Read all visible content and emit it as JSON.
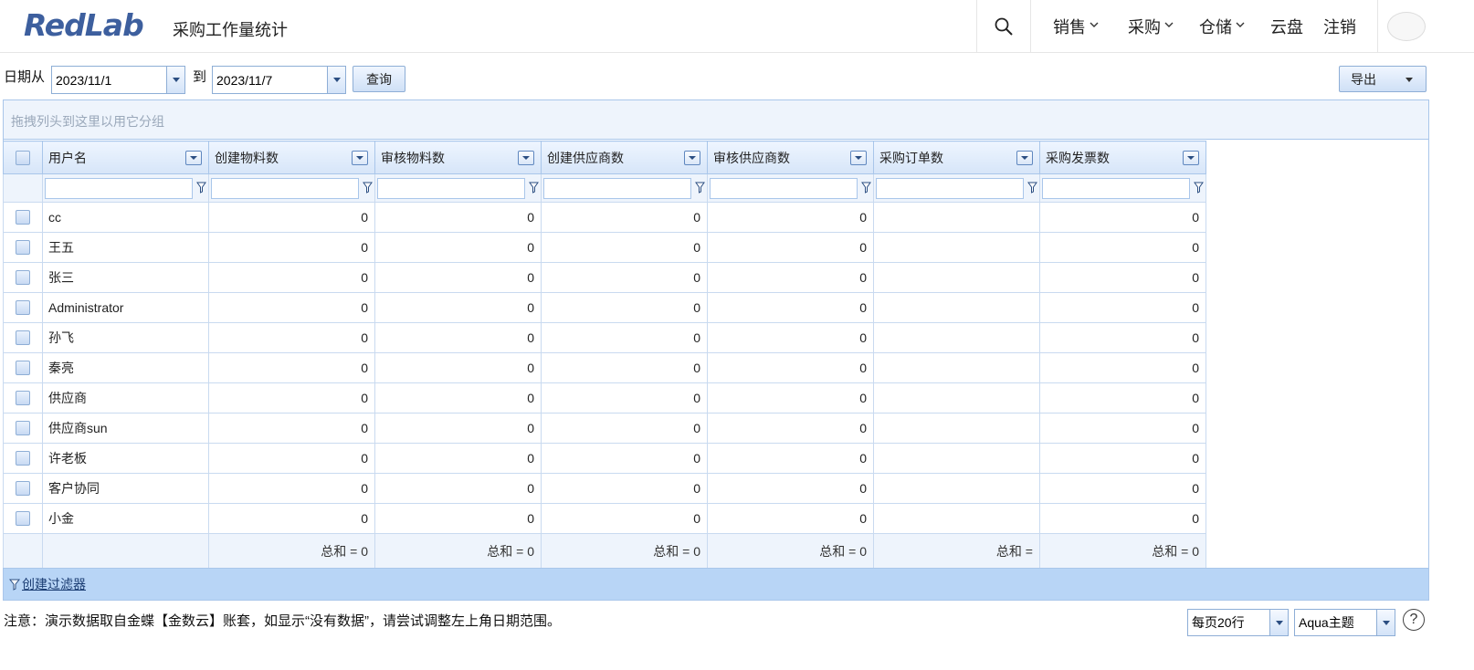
{
  "app": {
    "logo": "RedLab",
    "page_title": "采购工作量统计"
  },
  "nav": [
    {
      "label": "销售",
      "has_menu": true
    },
    {
      "label": "采购",
      "has_menu": true
    },
    {
      "label": "仓储",
      "has_menu": true
    },
    {
      "label": "云盘",
      "has_menu": false
    },
    {
      "label": "注销",
      "has_menu": false
    }
  ],
  "toolbar": {
    "date_from_label": "日期从",
    "date_from": "2023/11/1",
    "to_label": "到",
    "date_to": "2023/11/7",
    "query_label": "查询",
    "export_label": "导出"
  },
  "grid": {
    "group_hint": "拖拽列头到这里以用它分组",
    "columns": [
      "用户名",
      "创建物料数",
      "审核物料数",
      "创建供应商数",
      "审核供应商数",
      "采购订单数",
      "采购发票数"
    ],
    "rows": [
      {
        "name": "cc",
        "values": [
          "0",
          "0",
          "0",
          "0",
          "",
          "0"
        ]
      },
      {
        "name": "王五",
        "values": [
          "0",
          "0",
          "0",
          "0",
          "",
          "0"
        ]
      },
      {
        "name": "张三",
        "values": [
          "0",
          "0",
          "0",
          "0",
          "",
          "0"
        ]
      },
      {
        "name": "Administrator",
        "values": [
          "0",
          "0",
          "0",
          "0",
          "",
          "0"
        ]
      },
      {
        "name": "孙飞",
        "values": [
          "0",
          "0",
          "0",
          "0",
          "",
          "0"
        ]
      },
      {
        "name": "秦亮",
        "values": [
          "0",
          "0",
          "0",
          "0",
          "",
          "0"
        ]
      },
      {
        "name": "供应商",
        "values": [
          "0",
          "0",
          "0",
          "0",
          "",
          "0"
        ]
      },
      {
        "name": "供应商sun",
        "values": [
          "0",
          "0",
          "0",
          "0",
          "",
          "0"
        ]
      },
      {
        "name": "许老板",
        "values": [
          "0",
          "0",
          "0",
          "0",
          "",
          "0"
        ]
      },
      {
        "name": "客户协同",
        "values": [
          "0",
          "0",
          "0",
          "0",
          "",
          "0"
        ]
      },
      {
        "name": "小金",
        "values": [
          "0",
          "0",
          "0",
          "0",
          "",
          "0"
        ]
      }
    ],
    "totals": [
      "总和 = 0",
      "总和 = 0",
      "总和 = 0",
      "总和 = 0",
      "总和 =",
      "总和 = 0"
    ],
    "create_filter_label": "创建过滤器"
  },
  "footer": {
    "note": "注意：演示数据取自金蝶【金数云】账套，如显示“没有数据”，请尝试调整左上角日期范围。",
    "page_size": "每页20行",
    "theme": "Aqua主题",
    "help": "?"
  },
  "colors": {
    "accent": "#3d5f9e",
    "grid_border": "#a9c6ea",
    "filter_bar": "#b8d5f6"
  }
}
